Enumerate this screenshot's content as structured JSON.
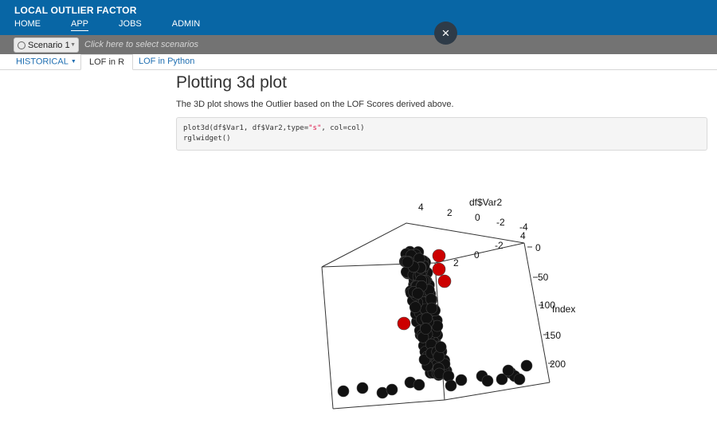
{
  "header": {
    "title": "LOCAL OUTLIER FACTOR",
    "nav": [
      "HOME",
      "APP",
      "JOBS",
      "ADMIN"
    ],
    "close_label": "×"
  },
  "scenario": {
    "selected": "Scenario 1",
    "hint": "Click here to select scenarios"
  },
  "tabs": [
    {
      "label": "HISTORICAL",
      "active": false
    },
    {
      "label": "LOF in R",
      "active": true
    },
    {
      "label": "LOF in Python",
      "active": false
    }
  ],
  "main": {
    "title": "Plotting 3d plot",
    "description": "The 3D plot shows the Outlier based on the LOF Scores derived above.",
    "code": {
      "line1_prefix": "plot3d(df$Var1, df$Var2,type=",
      "line1_string": "\"s\"",
      "line1_suffix": ", col=col)",
      "line2": "rglwidget()"
    }
  },
  "plot": {
    "axis_var2_label": "df$Var2",
    "axis_var2_ticks": [
      "4",
      "2",
      "0",
      "-2",
      "-4"
    ],
    "axis_var1_ticks": [
      "4",
      "2",
      "0",
      "-2"
    ],
    "axis_index_label": "Index",
    "axis_index_ticks": [
      "0",
      "50",
      "100",
      "150",
      "200"
    ],
    "colors": {
      "normal": "#111111",
      "outlier": "#cc0000"
    }
  }
}
